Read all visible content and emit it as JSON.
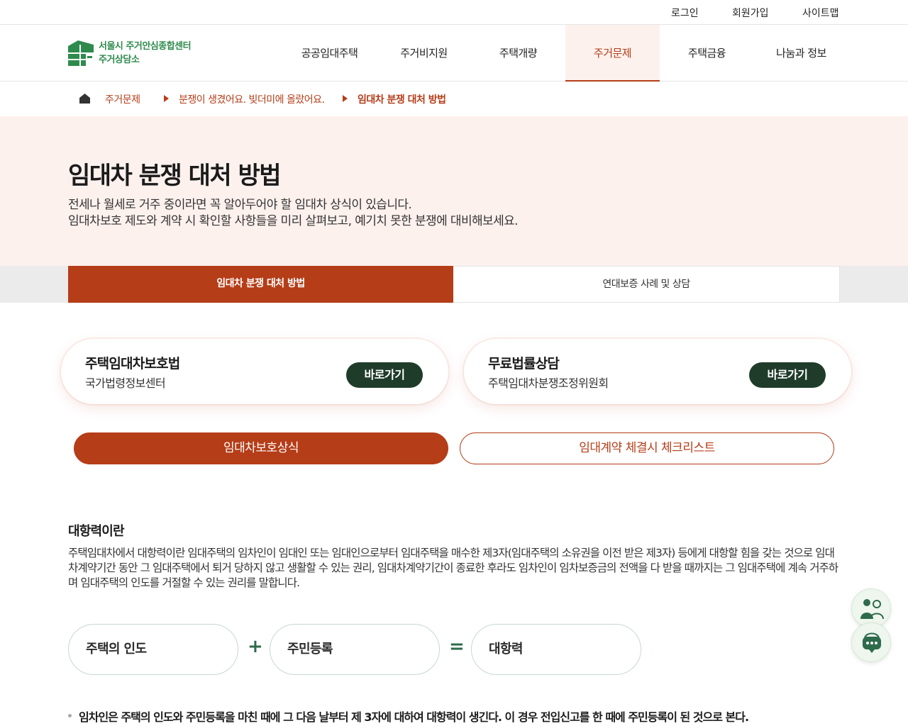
{
  "util_nav": [
    "로그인",
    "회원가입",
    "사이트맵"
  ],
  "logo": {
    "line1": "서울시 주거안심종합센터",
    "line2": "주거상담소"
  },
  "gnb": [
    {
      "label": "공공임대주택"
    },
    {
      "label": "주거비지원"
    },
    {
      "label": "주택개량"
    },
    {
      "label": "주거문제"
    },
    {
      "label": "주택금융"
    },
    {
      "label": "나눔과 정보"
    }
  ],
  "breadcrumb": [
    "주거문제",
    "분쟁이 생겼어요. 빚더미에 올랐어요.",
    "임대차 분쟁 대처 방법"
  ],
  "hero": {
    "title": "임대차 분쟁 대처 방법",
    "desc1": "전세나 월세로 거주 중이라면 꼭 알아두어야 할 임대차 상식이 있습니다.",
    "desc2": "임대차보호 제도와 계약 시 확인할 사항들을 미리 살펴보고, 예기치 못한 분쟁에 대비해보세요."
  },
  "tabs": [
    "임대차 분쟁 대처 방법",
    "연대보증 사례 및 상담"
  ],
  "cards": [
    {
      "title": "주택임대차보호법",
      "sub": "국가법령정보센터",
      "button": "바로가기"
    },
    {
      "title": "무료법률상담",
      "sub": "주택임대차분쟁조정위원회",
      "button": "바로가기"
    }
  ],
  "pills": [
    "임대차보호상식",
    "임대계약 체결시 체크리스트"
  ],
  "section": {
    "title": "대항력이란",
    "body": "주택임대차에서 대항력이란 임대주택의 임차인이 임대인 또는 임대인으로부터 임대주택을 매수한 제3자(임대주택의 소유권을 이전 받은 제3자) 등에게 대항할 힘을 갖는 것으로 임대차계약기간 동안 그 임대주택에서 퇴거 당하지 않고 생활할 수 있는 권리, 임대차계약기간이 종료한 후라도 임차인이 임차보증금의 전액을 다 받을 때까지는 그 임대주택에 계속 거주하며 임대주택의 인도를 거절할 수 있는 권리를 말합니다.",
    "formula": [
      "주택의 인도",
      "주민등록",
      "대항력"
    ],
    "ops": [
      "+",
      "="
    ],
    "note": "임차인은 주택의 인도와 주민등록을 마친 때에 그 다음 날부터 제 3자에 대하여 대항력이 생긴다. 이 경우 전입신고를 한 때에 주민등록이 된 것으로 본다."
  },
  "colors": {
    "accent": "#b53d18",
    "brand": "#2e8b4d",
    "dark_button": "#1f3c2b",
    "hero_bg": "#fdf1ee"
  }
}
